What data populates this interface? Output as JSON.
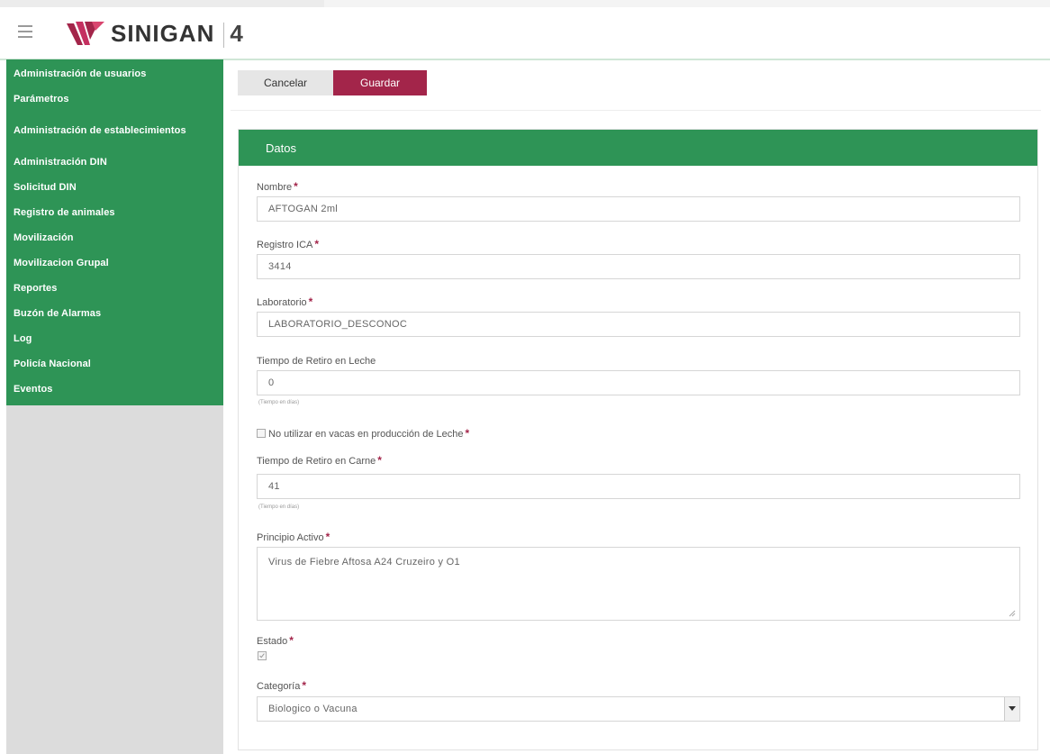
{
  "header": {
    "brand": "SINIGAN",
    "version": "4"
  },
  "sidebar": {
    "items": [
      {
        "label": "Administración de usuarios"
      },
      {
        "label": "Parámetros"
      },
      {
        "label": "Administración de establecimientos"
      },
      {
        "label": "Administración DIN"
      },
      {
        "label": "Solicitud DIN"
      },
      {
        "label": "Registro de animales"
      },
      {
        "label": "Movilización"
      },
      {
        "label": "Movilizacion Grupal"
      },
      {
        "label": "Reportes"
      },
      {
        "label": "Buzón de Alarmas"
      },
      {
        "label": "Log"
      },
      {
        "label": "Policía Nacional"
      },
      {
        "label": "Eventos"
      }
    ]
  },
  "toolbar": {
    "cancel_label": "Cancelar",
    "save_label": "Guardar"
  },
  "panel": {
    "title": "Datos"
  },
  "form": {
    "nombre": {
      "label": "Nombre",
      "value": "AFTOGAN 2ml"
    },
    "registro": {
      "label": "Registro ICA",
      "value": "3414"
    },
    "laboratorio": {
      "label": "Laboratorio",
      "value": "LABORATORIO_DESCONOC"
    },
    "retiro_leche": {
      "label": "Tiempo de Retiro en Leche",
      "value": "0",
      "help": "(Tiempo en días)"
    },
    "no_vacas": {
      "label": "No utilizar en vacas en producción de Leche",
      "checked": false
    },
    "retiro_carne": {
      "label": "Tiempo de Retiro en Carne",
      "value": "41",
      "help": "(Tiempo en días)"
    },
    "principio": {
      "label": "Principio Activo",
      "value": "Virus de Fiebre Aftosa A24 Cruzeiro y O1"
    },
    "estado": {
      "label": "Estado",
      "checked": true
    },
    "categoria": {
      "label": "Categoría",
      "value": "Biologico o Vacuna"
    }
  },
  "colors": {
    "primary_green": "#2e9456",
    "accent_red": "#a3254a"
  }
}
